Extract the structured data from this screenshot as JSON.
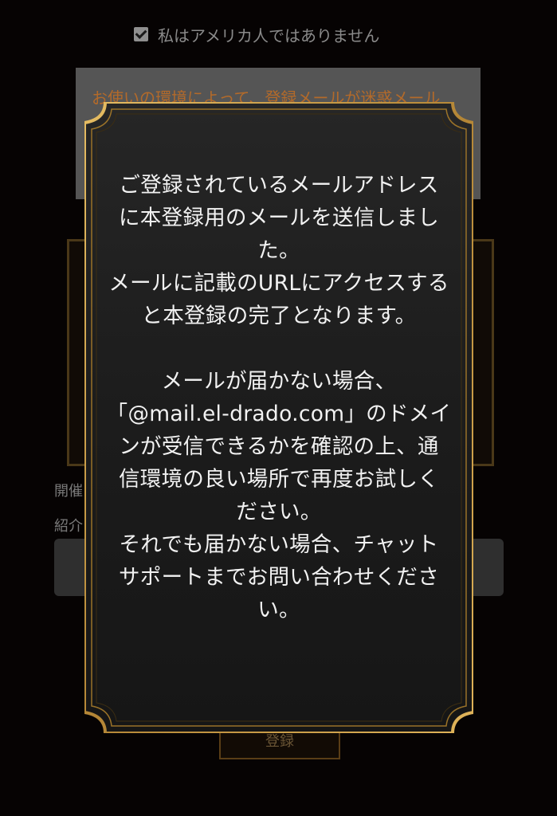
{
  "background": {
    "checkbox_label": "私はアメリカ人ではありません",
    "checkbox_checked": true,
    "notice_text": "お使いの環境によって、登録メールが迷惑メール",
    "label_1": "開催",
    "label_2": "紹介",
    "register_button": "登録"
  },
  "modal": {
    "paragraph_1": "ご登録されているメールアドレス\nに本登録用のメールを送信しまし\nた。\nメールに記載のURLにアクセスする\nと本登録の完了となります。",
    "paragraph_2": "メールが届かない場合、\n「@mail.el-drado.com」のドメイ\nンが受信できるかを確認の上、通\n信環境の良い場所で再度お試しく\nださい。\nそれでも届かない場合、チャット\nサポートまでお問い合わせくださ\nい。"
  },
  "colors": {
    "modal_background": "#1e1e1e",
    "frame_gold": "#d2a44a",
    "frame_gold_dark": "#8a6420",
    "text": "#f2f2f2"
  }
}
